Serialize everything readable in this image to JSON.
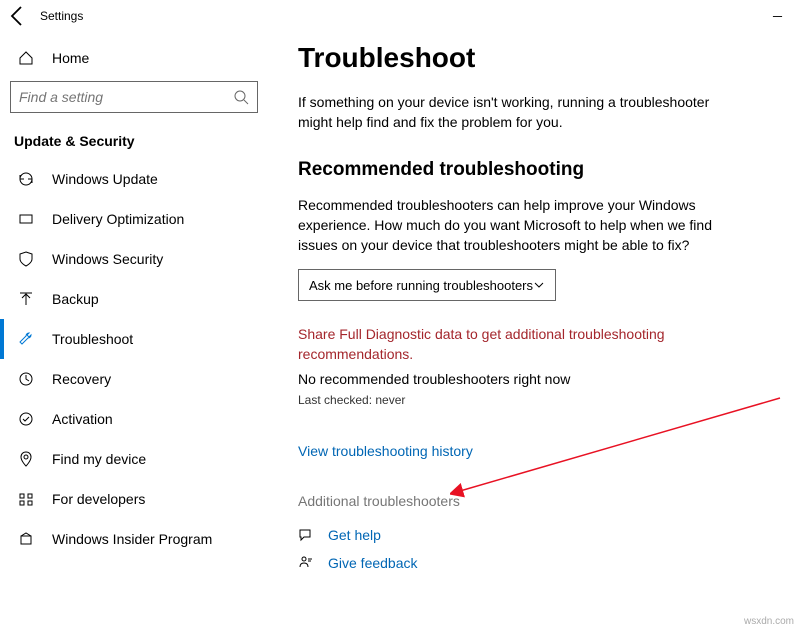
{
  "titlebar": {
    "title": "Settings"
  },
  "home_label": "Home",
  "search": {
    "placeholder": "Find a setting"
  },
  "section_title": "Update & Security",
  "nav": [
    {
      "label": "Windows Update"
    },
    {
      "label": "Delivery Optimization"
    },
    {
      "label": "Windows Security"
    },
    {
      "label": "Backup"
    },
    {
      "label": "Troubleshoot"
    },
    {
      "label": "Recovery"
    },
    {
      "label": "Activation"
    },
    {
      "label": "Find my device"
    },
    {
      "label": "For developers"
    },
    {
      "label": "Windows Insider Program"
    }
  ],
  "main": {
    "heading": "Troubleshoot",
    "intro": "If something on your device isn't working, running a troubleshooter might help find and fix the problem for you.",
    "rec_heading": "Recommended troubleshooting",
    "rec_para": "Recommended troubleshooters can help improve your Windows experience. How much do you want Microsoft to help when we find issues on your device that troubleshooters might be able to fix?",
    "dropdown_value": "Ask me before running troubleshooters",
    "red_text": "Share Full Diagnostic data to get additional troubleshooting recommendations.",
    "no_rec": "No recommended troubleshooters right now",
    "last_checked": "Last checked: never",
    "history_link": "View troubleshooting history",
    "additional": "Additional troubleshooters",
    "get_help": "Get help",
    "give_feedback": "Give feedback"
  },
  "attribution": "wsxdn.com"
}
